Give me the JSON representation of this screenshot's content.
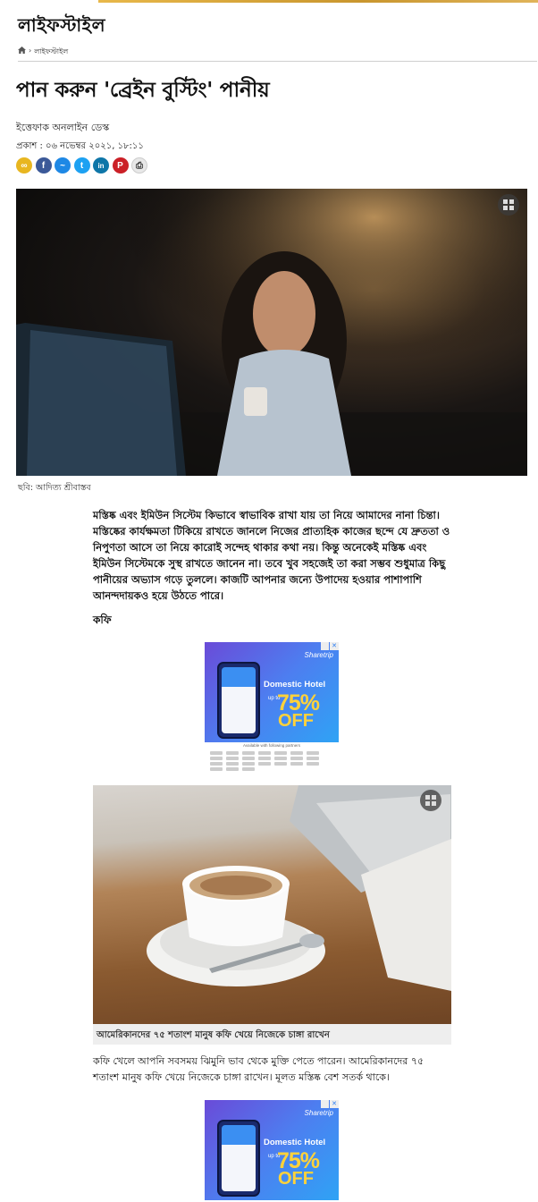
{
  "section": {
    "title": "লাইফস্টাইল"
  },
  "breadcrumb": {
    "items": [
      "লাইফস্টাইল"
    ]
  },
  "article": {
    "headline": "পান করুন 'ব্রেইন বুস্টিং' পানীয়",
    "author": "ইত্তেফাক অনলাইন ডেস্ক",
    "published": "প্রকাশ : ০৬ নভেম্বর ২০২১, ১৮:১১",
    "hero_caption": "ছবি: আদিত্য শ্রীবাস্তব",
    "lead": "মস্তিষ্ক এবং ইমিউন সিস্টেম কিভাবে স্বাভাবিক রাখা যায় তা নিয়ে আমাদের নানা চিন্তা। মস্তিষ্কের কার্যক্ষমতা টিকিয়ে রাখতে জানলে নিজের প্রাত্যহিক কাজের ছন্দে যে দ্রুততা ও নিপুণতা আসে তা নিয়ে কারোই সন্দেহ থাকার কথা নয়। কিন্তু অনেকেই মস্তিষ্ক এবং ইমিউন সিস্টেমকে সুস্থ রাখতে জানেন না। তবে খুব সহজেই তা করা সম্ভব শুধুমাত্র কিছু পানীয়ের অভ্যাস গড়ে তুললে। কাজটি আপনার জন্যে উপাদেয় হওয়ার পাশাপাশি আনন্দদায়কও হয়ে উঠতে পারে।",
    "subheading_coffee": "কফি",
    "coffee_caption": "আমেরিকানদের ৭৫ শতাংশ মানুষ কফি খেয়ে নিজেকে চাঙ্গা রাখেন",
    "coffee_para": "কফি খেলে আপনি সবসময় ঝিমুনি ভাব থেকে মুক্তি পেতে পারেন। আমেরিকানদের ৭৫ শতাংশ মানুষ কফি খেয়ে নিজেকে চাঙ্গা রাখেন। মূলত মস্তিষ্ক বেশ সতর্ক থাকে।"
  },
  "share": {
    "buttons": [
      {
        "name": "copy-link",
        "icon": "link-icon",
        "glyph": "∞",
        "color": "#e8b620"
      },
      {
        "name": "facebook",
        "icon": "facebook-icon",
        "glyph": "f",
        "color": "#3b5998"
      },
      {
        "name": "messenger",
        "icon": "messenger-icon",
        "glyph": "~",
        "color": "#1e88e5"
      },
      {
        "name": "twitter",
        "icon": "twitter-icon",
        "glyph": "t",
        "color": "#1da1f2"
      },
      {
        "name": "linkedin",
        "icon": "linkedin-icon",
        "glyph": "in",
        "color": "#0e76a8"
      },
      {
        "name": "pinterest",
        "icon": "pinterest-icon",
        "glyph": "P",
        "color": "#cb2027"
      },
      {
        "name": "print",
        "icon": "print-icon",
        "glyph": "⎙",
        "color": "#e8e8e8"
      }
    ]
  },
  "ad": {
    "brand": "Sharetrip",
    "headline": "Domestic Hotel",
    "upto": "up to",
    "percent": "75%",
    "off": "OFF",
    "partners_label": "Available with following partners"
  },
  "colors": {
    "accent": "#111111",
    "caption_bg": "#eeeeee"
  }
}
